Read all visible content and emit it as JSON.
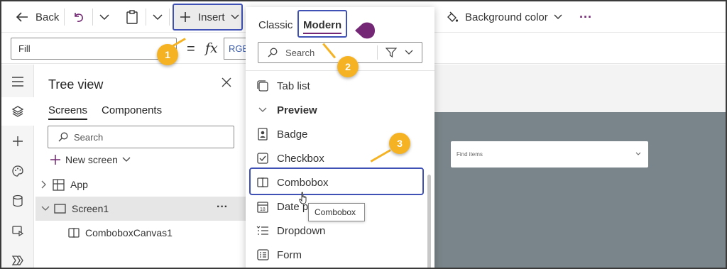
{
  "toolbar": {
    "back": "Back",
    "insert": "Insert",
    "background_color": "Background color"
  },
  "formula": {
    "property": "Fill",
    "fx": "fx",
    "value": "RGBA("
  },
  "tree": {
    "title": "Tree view",
    "tabs": [
      "Screens",
      "Components"
    ],
    "search_placeholder": "Search",
    "new_screen": "New screen",
    "nodes": [
      "App",
      "Screen1",
      "ComboboxCanvas1"
    ]
  },
  "flyout": {
    "tabs": [
      "Classic",
      "Modern"
    ],
    "search_placeholder": "Search",
    "items": [
      "Tab list",
      "Preview",
      "Badge",
      "Checkbox",
      "Combobox",
      "Date p",
      "Dropdown",
      "Form"
    ]
  },
  "canvas": {
    "combobox_placeholder": "Find items"
  },
  "tooltip": "Combobox",
  "callouts": [
    "1",
    "2",
    "3"
  ],
  "colors": {
    "accent": "#3f51b5",
    "callout": "#f5b324",
    "canvas": "#79858a",
    "purple": "#742774"
  }
}
